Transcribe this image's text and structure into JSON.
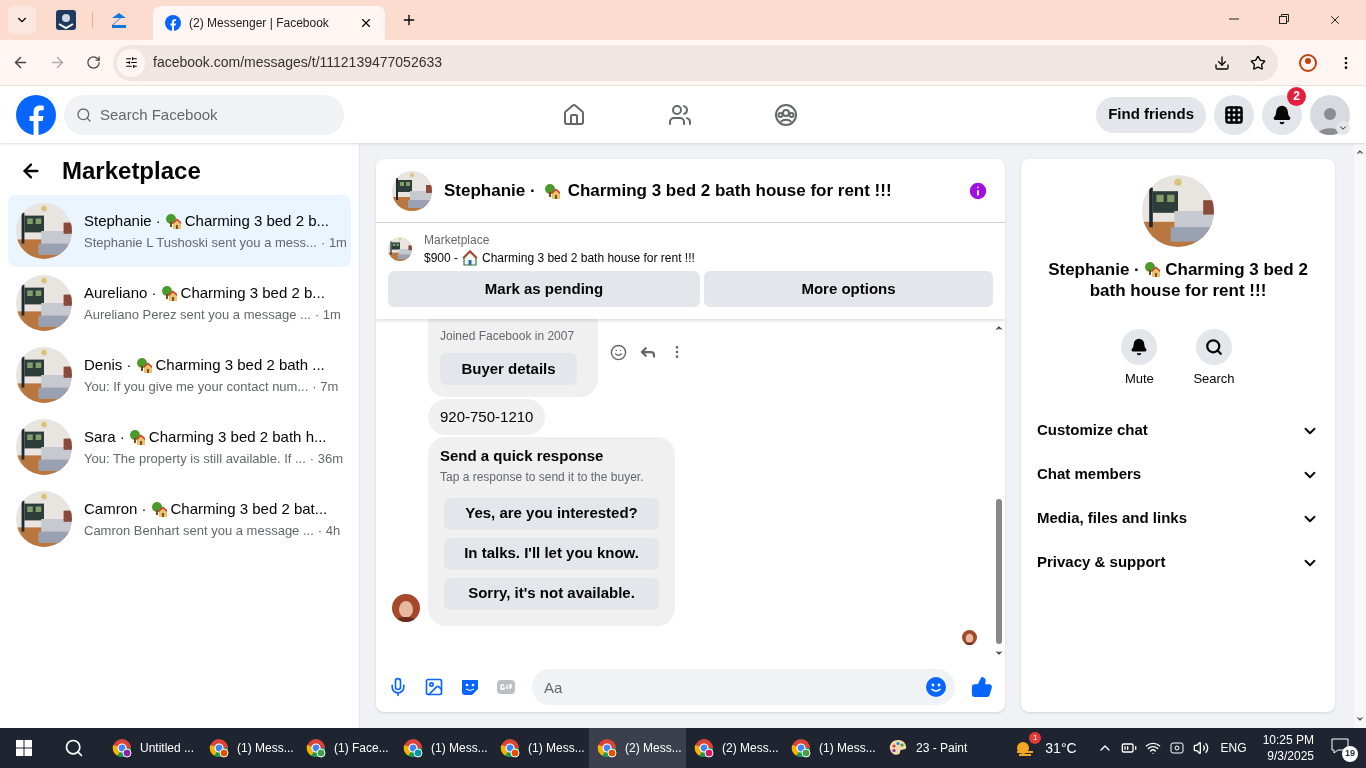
{
  "browser": {
    "tab_title": "(2) Messenger | Facebook",
    "url": "facebook.com/messages/t/1112139477052633"
  },
  "header": {
    "search_placeholder": "Search Facebook",
    "find_friends": "Find friends",
    "notification_count": "2"
  },
  "sidebar": {
    "title": "Marketplace",
    "conversations": [
      {
        "name": "Stephanie ·",
        "title": "Charming 3 bed 2 b...",
        "preview": "Stephanie L Tushoski sent you a mess...",
        "time": "· 1m",
        "selected": true
      },
      {
        "name": "Aureliano ·",
        "title": "Charming 3 bed 2 b...",
        "preview": "Aureliano Perez sent you a message ...",
        "time": "· 1m",
        "selected": false
      },
      {
        "name": "Denis ·",
        "title": "Charming 3 bed 2 bath ...",
        "preview": "You: If you give me your contact num...",
        "time": "· 7m",
        "selected": false
      },
      {
        "name": "Sara ·",
        "title": "Charming 3 bed 2 bath h...",
        "preview": "You: The property is still available. If ...",
        "time": "· 36m",
        "selected": false
      },
      {
        "name": "Camron ·",
        "title": "Charming 3 bed 2 bat...",
        "preview": "Camron Benhart sent you a message ...",
        "time": "· 4h",
        "selected": false
      }
    ]
  },
  "chat": {
    "name": "Stephanie ·",
    "title": "Charming 3 bed 2 bath house for rent !!!",
    "listing": {
      "source": "Marketplace",
      "price": "$900 -",
      "title": "Charming 3 bed 2 bath house for rent !!!",
      "actions": [
        "Mark as pending",
        "More options"
      ]
    },
    "buyer_card": {
      "joined": "Joined Facebook in 2007",
      "button": "Buyer details"
    },
    "phone": "920-750-1210",
    "quick_response": {
      "title": "Send a quick response",
      "hint": "Tap a response to send it to the buyer.",
      "options": [
        "Yes, are you interested?",
        "In talks. I'll let you know.",
        "Sorry, it's not available."
      ]
    },
    "composer_placeholder": "Aa"
  },
  "details": {
    "name": "Stephanie ·",
    "title": "Charming 3 bed 2 bath house for rent !!!",
    "actions": [
      {
        "kind": "mute",
        "label": "Mute"
      },
      {
        "kind": "search",
        "label": "Search"
      }
    ],
    "sections": [
      "Customize chat",
      "Chat members",
      "Media, files and links",
      "Privacy & support"
    ]
  },
  "taskbar": {
    "apps": [
      {
        "kind": "chrome",
        "label": "Untitled ...",
        "selected": false
      },
      {
        "kind": "chrome",
        "label": "(1) Mess...",
        "selected": false
      },
      {
        "kind": "chrome",
        "label": "(1) Face...",
        "selected": false
      },
      {
        "kind": "chrome",
        "label": "(1) Mess...",
        "selected": false
      },
      {
        "kind": "chrome",
        "label": "(1) Mess...",
        "selected": false
      },
      {
        "kind": "chrome",
        "label": "(2) Mess...",
        "selected": true
      },
      {
        "kind": "chrome",
        "label": "(2) Mess...",
        "selected": false
      },
      {
        "kind": "chrome",
        "label": "(1) Mess...",
        "selected": false
      },
      {
        "kind": "paint",
        "label": "23 - Paint",
        "selected": false
      }
    ],
    "weather_badge": "1",
    "temperature": "31°C",
    "language": "ENG",
    "time": "10:25 PM",
    "date": "9/3/2025",
    "notifications": "19"
  }
}
